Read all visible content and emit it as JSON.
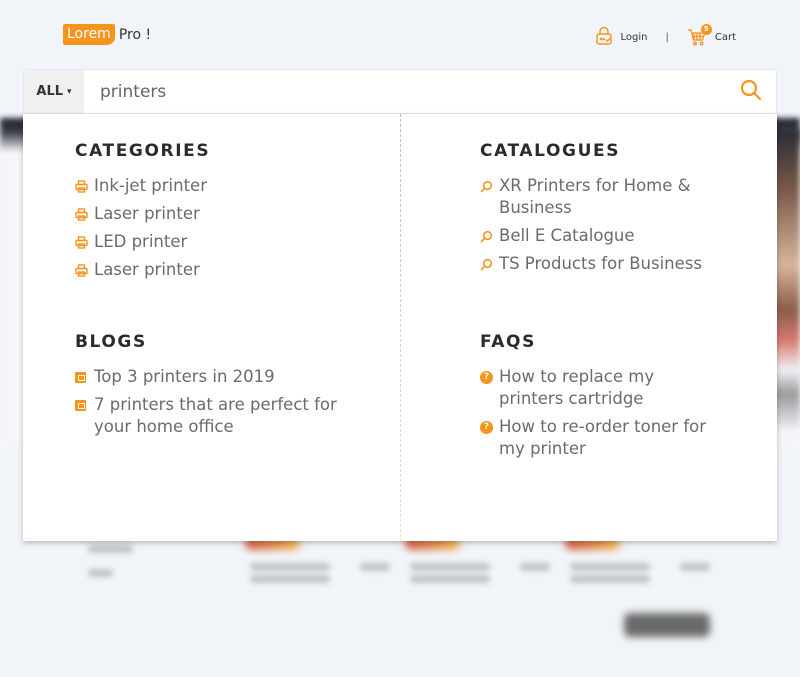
{
  "brand": {
    "badge_text": "Lorem",
    "rest_text": "Pro !",
    "accent_color": "#f7941d"
  },
  "header": {
    "login_label": "Login",
    "login_icon": "lock-icon",
    "separator": "|",
    "cart_label": "Cart",
    "cart_icon": "cart-icon",
    "cart_count": "5"
  },
  "search": {
    "category_label": "ALL",
    "category_caret": "▾",
    "query": "printers",
    "search_icon": "search-icon"
  },
  "results": {
    "categories": {
      "title": "CATEGORIES",
      "icon": "printer-icon",
      "items": [
        {
          "label": "Ink-jet printer"
        },
        {
          "label": "Laser printer"
        },
        {
          "label": "LED printer"
        },
        {
          "label": "Laser printer"
        }
      ]
    },
    "catalogues": {
      "title": "CATALOGUES",
      "icon": "magnifier-icon",
      "items": [
        {
          "label": "XR Printers for Home & Business"
        },
        {
          "label": "Bell E Catalogue"
        },
        {
          "label": "TS Products for Business"
        }
      ]
    },
    "blogs": {
      "title": "BLOGS",
      "icon": "blog-icon",
      "items": [
        {
          "label": "Top 3 printers in 2019"
        },
        {
          "label": "7 printers that are perfect for your home office"
        }
      ]
    },
    "faqs": {
      "title": "FAQS",
      "icon": "question-icon",
      "items": [
        {
          "label": "How to replace my printers cartridge"
        },
        {
          "label": "How to re-order toner for my printer"
        }
      ]
    }
  }
}
